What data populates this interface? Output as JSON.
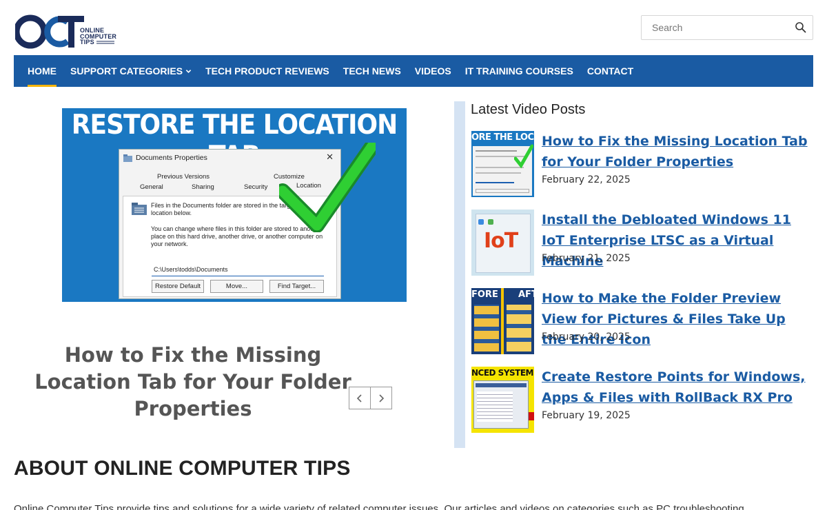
{
  "header": {
    "logo_text_line1": "ONLINE",
    "logo_text_line2": "COMPUTER",
    "logo_text_line3": "TIPS",
    "search_placeholder": "Search"
  },
  "nav": {
    "items": [
      {
        "label": "HOME",
        "active": true
      },
      {
        "label": "SUPPORT CATEGORIES",
        "dropdown": true
      },
      {
        "label": "TECH PRODUCT REVIEWS"
      },
      {
        "label": "TECH NEWS"
      },
      {
        "label": "VIDEOS"
      },
      {
        "label": "IT TRAINING COURSES"
      },
      {
        "label": "CONTACT"
      }
    ]
  },
  "slider": {
    "banner": "RESTORE THE LOCATION TAB",
    "dialog": {
      "title": "Documents Properties",
      "tab_previous_versions": "Previous Versions",
      "tab_customize": "Customize",
      "tab_general": "General",
      "tab_sharing": "Sharing",
      "tab_security": "Security",
      "tab_location": "Location",
      "text1": "Files in the Documents folder are stored in the target location below.",
      "text2": "You can change where files in this folder are stored to another place on this hard drive, another drive, or another computer on your network.",
      "path": "C:\\Users\\todds\\Documents",
      "btn_restore": "Restore Default",
      "btn_move": "Move...",
      "btn_find": "Find Target..."
    },
    "title": "How to Fix the Missing Location Tab for Your Folder Properties"
  },
  "sidebar": {
    "title": "Latest Video Posts",
    "posts": [
      {
        "title": "How to Fix the Missing Location Tab for Your Folder Properties",
        "date": "February 22, 2025",
        "thumb_text": "ORE THE LOCATIO"
      },
      {
        "title": "Install the Debloated Windows 11 IoT Enterprise LTSC as a Virtual Machine",
        "date": "February 21, 2025",
        "thumb_text": "IoT"
      },
      {
        "title": "How to Make the Folder Preview View for Pictures & Files Take Up the Entire Icon",
        "date": "February 20, 2025",
        "thumb_text_left": "FORE",
        "thumb_text_right": "AFT"
      },
      {
        "title": "Create Restore Points for Windows, Apps & Files with RollBack RX Pro",
        "date": "February 19, 2025",
        "thumb_text": "NCED SYSTEM RES"
      }
    ]
  },
  "about": {
    "heading": "ABOUT ONLINE COMPUTER TIPS",
    "text": "Online Computer Tips provide tips and solutions for a wide variety of related computer issues. Our articles and videos on categories such as PC troubleshooting"
  },
  "colors": {
    "nav_bg": "#1a5ba3",
    "nav_active_underline": "#f5b400",
    "link": "#1a5ba3",
    "sidebar_accent": "#d5e3f3"
  }
}
